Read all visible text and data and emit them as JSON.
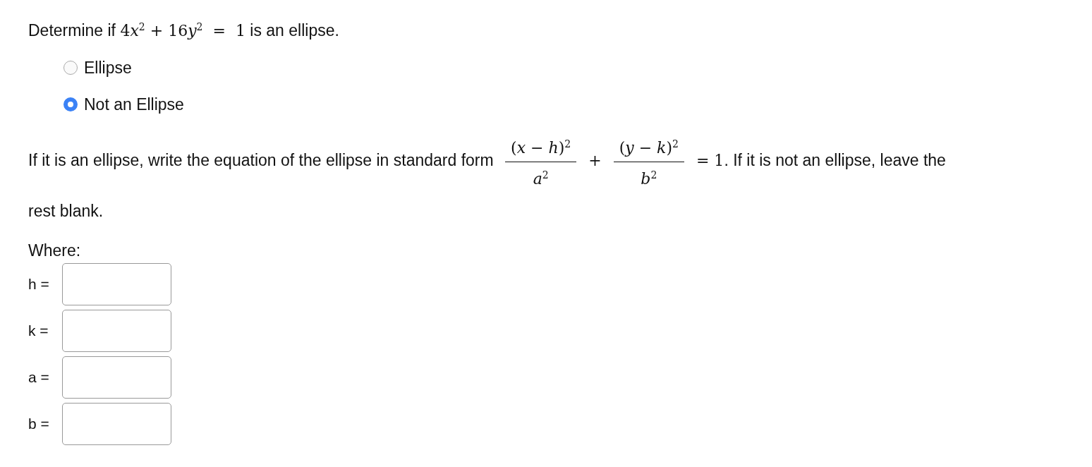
{
  "question": {
    "segments": [
      {
        "kind": "text",
        "text": "Determine if "
      },
      {
        "kind": "math",
        "text": "4"
      },
      {
        "kind": "mathvar",
        "text": "x"
      },
      {
        "kind": "math",
        "text": "$^{2}$ + 16"
      },
      {
        "kind": "mathvar",
        "text": "y"
      },
      {
        "kind": "math",
        "text": "$^{2}$  =  1"
      },
      {
        "kind": "text",
        "text": " is an ellipse."
      }
    ]
  },
  "choices": [
    {
      "label": "Ellipse",
      "selected": false
    },
    {
      "label": "Not an Ellipse",
      "selected": true
    }
  ],
  "instructions": {
    "segments": [
      {
        "kind": "text",
        "text": "If it is an ellipse, write the equation of the ellipse in standard form "
      },
      {
        "kind": "fraction",
        "numerator": "(*x* − *h*)$^{2}$",
        "denominator": "*a*$^{2}$"
      },
      {
        "kind": "math",
        "text": " + "
      },
      {
        "kind": "fraction",
        "numerator": "(*y* − *k*)$^{2}$",
        "denominator": "*b*$^{2}$"
      },
      {
        "kind": "math",
        "text": " = 1"
      },
      {
        "kind": "text",
        "text": ". If it is not an ellipse, leave the rest blank."
      }
    ]
  },
  "where_label": "Where:",
  "fields": [
    {
      "label": "h ="
    },
    {
      "label": "k ="
    },
    {
      "label": "a ="
    },
    {
      "label": "b ="
    }
  ]
}
